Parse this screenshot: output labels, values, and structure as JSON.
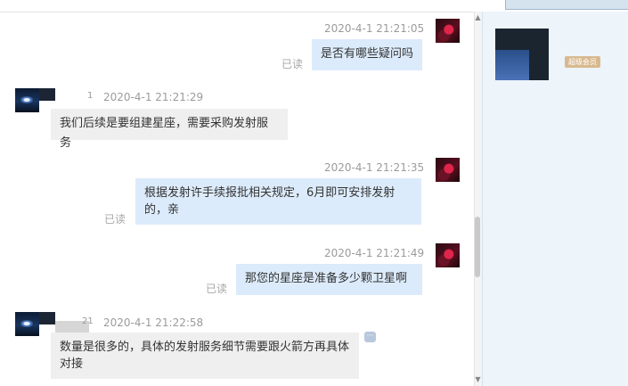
{
  "messages": [
    {
      "side": "me",
      "timestamp": "2020-4-1 21:21:05",
      "text": "是否有哪些疑问吗",
      "status": "已读"
    },
    {
      "side": "them",
      "sender_index": "1",
      "timestamp": "2020-4-1 21:21:29",
      "text": "我们后续是要组建星座，需要采购发射服务"
    },
    {
      "side": "me",
      "timestamp": "2020-4-1 21:21:35",
      "lines": [
        "根据发射许手续报批相关规定，6月即可安排发射",
        "的，亲"
      ],
      "status": "已读"
    },
    {
      "side": "me",
      "timestamp": "2020-4-1 21:21:49",
      "text": "那您的星座是准备多少颗卫星啊",
      "status": "已读"
    },
    {
      "side": "them",
      "sender_index": "21",
      "timestamp": "2020-4-1 21:22:58",
      "lines": [
        "数量是很多的，具体的发射服务细节需要跟火箭方再具体",
        "对接"
      ]
    }
  ],
  "sidebar": {
    "member_badge": "超级会员"
  },
  "icons": {
    "feedback": "chat-bubble-icon",
    "scroll_up": "arrow-up-icon",
    "scroll_down": "arrow-down-icon"
  }
}
